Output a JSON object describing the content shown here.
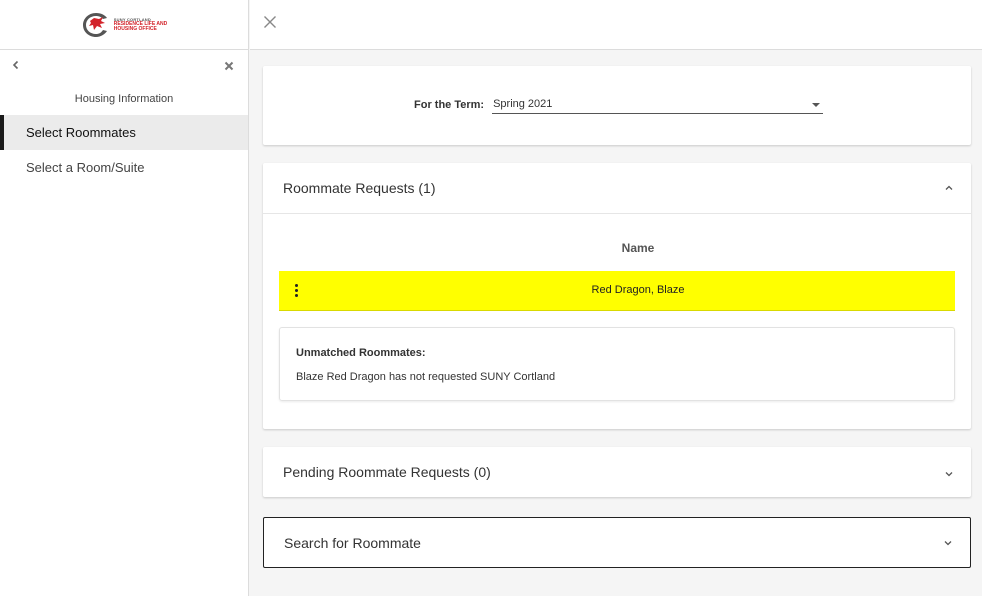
{
  "logo": {
    "line1": "SUNY CORTLAND",
    "line2": "RESIDENCE LIFE AND",
    "line3": "HOUSING OFFICE",
    "icon": "red-dragon-logo",
    "brand_color": "#d2232a"
  },
  "sidebar": {
    "heading": "Housing Information",
    "items": [
      {
        "label": "Select Roommates",
        "active": true
      },
      {
        "label": "Select a Room/Suite",
        "active": false
      }
    ]
  },
  "term": {
    "label": "For the Term:",
    "value": "Spring 2021"
  },
  "requests": {
    "title": "Roommate Requests (1)",
    "column_header": "Name",
    "rows": [
      {
        "name": "Red Dragon, Blaze",
        "highlight_color": "#ffff00"
      }
    ],
    "unmatched": {
      "title": "Unmatched Roommates:",
      "text": "Blaze Red Dragon has not requested SUNY Cortland"
    }
  },
  "pending": {
    "title": "Pending Roommate Requests (0)"
  },
  "search": {
    "title": "Search for Roommate"
  }
}
